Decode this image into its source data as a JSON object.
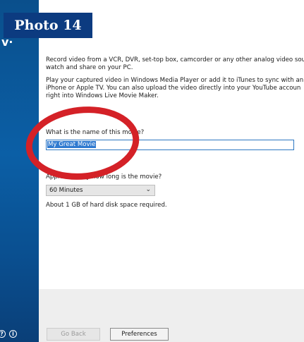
{
  "badge": {
    "text": "Photo 14"
  },
  "sidebar": {
    "logo_fragment": "v·"
  },
  "intro": {
    "line1a": "Record video from a VCR, DVR, set-top box, camcorder or any other analog video sou",
    "line1b": "watch and share on your PC.",
    "line2a": "Play your captured video in Windows Media Player or add it to iTunes to sync with an",
    "line2b": "iPhone or Apple TV. You can also upload the video directly into your YouTube accoun",
    "line2c": "right into Windows Live Movie Maker."
  },
  "name_field": {
    "label": "What is the name of this movie?",
    "value": "My Great Movie"
  },
  "length_field": {
    "label": "Approximately how long is the movie?",
    "selected": "60 Minutes",
    "note": "About 1 GB of hard disk space required."
  },
  "buttons": {
    "back": "Go Back",
    "preferences": "Preferences"
  },
  "icons": {
    "help": "help-circle-icon",
    "info": "info-circle-icon",
    "chevron": "chevron-down-icon"
  },
  "colors": {
    "sidebar": "#0b5fa6",
    "badge": "#0c3b80",
    "annotation": "#d42127",
    "selection": "#2f7ad0"
  }
}
